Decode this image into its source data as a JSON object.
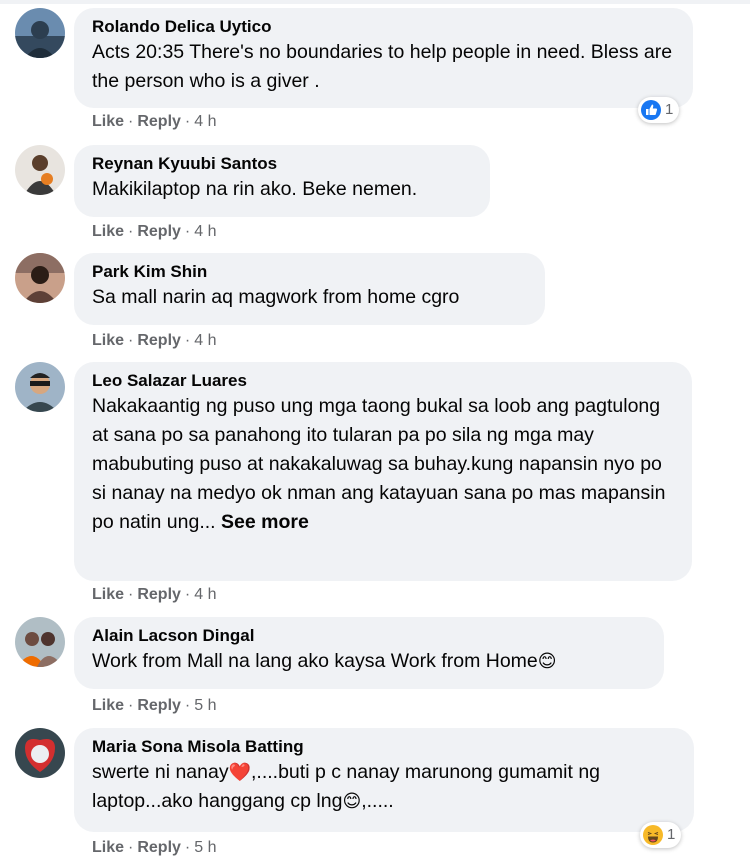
{
  "actions": {
    "like_label": "Like",
    "reply_label": "Reply",
    "sep": "·"
  },
  "colors": {
    "bubble_bg": "#f0f2f5",
    "name": "#050505",
    "meta": "#65676b",
    "like_blue": "#1877f2",
    "haha_yellow": "#f7b928"
  },
  "comments": [
    {
      "author": "Rolando Delica Uytico",
      "text": "Acts 20:35 There's no boundaries to help people in need. Bless are the person who is a giver .",
      "time": "4 h",
      "reaction": {
        "icon": "like-icon",
        "count": "1"
      }
    },
    {
      "author": "Reynan Kyuubi Santos",
      "text": "Makikilaptop na rin ako. Beke nemen.",
      "time": "4 h"
    },
    {
      "author": "Park Kim Shin",
      "text": "Sa mall narin aq magwork from home cgro",
      "time": "4 h"
    },
    {
      "author": "Leo Salazar Luares",
      "text": "Nakakaantig ng puso ung mga taong bukal sa loob ang pagtulong at sana po sa panahong ito tularan pa po sila ng mga may mabubuting puso at nakakaluwag sa buhay.kung napansin nyo po si nanay na medyo ok nman ang katayuan sana po mas mapansin po natin ung...",
      "see_more": "See more",
      "time": "4 h"
    },
    {
      "author": "Alain Lacson Dingal",
      "text": "Work from Mall na lang ako kaysa Work from Home",
      "emoji": "smiling-face-icon",
      "time": "5 h"
    },
    {
      "author": "Maria Sona Misola Batting",
      "text_a": "swerte ni nanay",
      "emoji_a": "red-heart-icon",
      "text_b": ",....buti p c nanay marunong gumamit ng laptop...ako hanggang cp lng",
      "emoji_b": "smiling-face-icon",
      "text_c": ",.....",
      "time": "5 h",
      "reaction": {
        "icon": "haha-icon",
        "count": "1"
      }
    }
  ]
}
